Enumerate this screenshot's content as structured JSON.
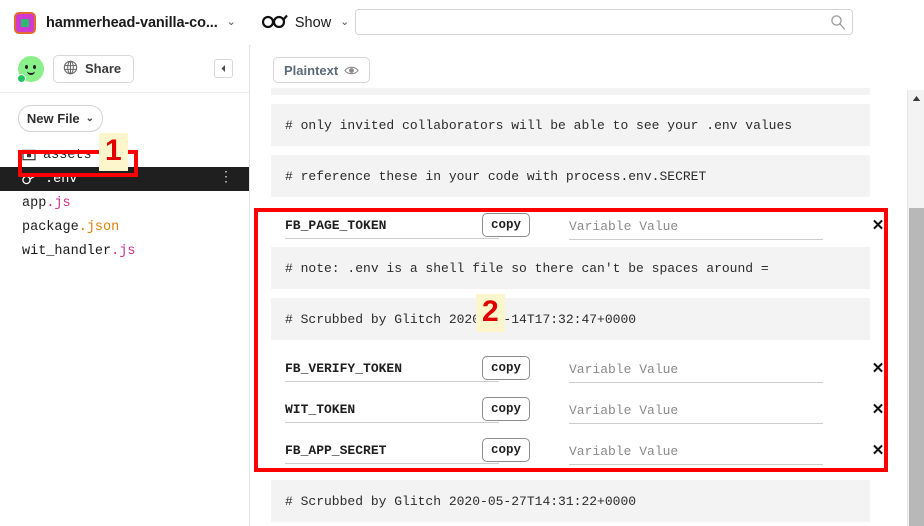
{
  "topbar": {
    "app_icon": "glitch-logo-icon",
    "project_name": "hammerhead-vanilla-co...",
    "project_chevron": "⌄",
    "show_icon": "glasses-icon",
    "show_label": "Show",
    "show_chevron": "⌄",
    "search": {
      "value": "",
      "placeholder": "",
      "icon": "search-icon"
    }
  },
  "sidebar": {
    "avatar": "user-avatar",
    "share_icon": "globe-icon",
    "share_label": "Share",
    "collapse_icon": "collapse-panel-icon",
    "new_file_label": "New File",
    "new_file_chevron": "⌄",
    "files": [
      {
        "name": "assets",
        "icon": "folder-icon",
        "active": false,
        "ext": ""
      },
      {
        "name": ".env",
        "icon": "key-icon",
        "active": true,
        "ext": ""
      },
      {
        "name": "app",
        "ext": ".js",
        "ext_class": "ext-js",
        "icon": "",
        "active": false
      },
      {
        "name": "package",
        "ext": ".json",
        "ext_class": "ext-json",
        "icon": "",
        "active": false
      },
      {
        "name": "wit_handler",
        "ext": ".js",
        "ext_class": "ext-js",
        "icon": "",
        "active": false
      }
    ],
    "kebab_glyph": "⋮"
  },
  "main": {
    "plaintext_label": "Plaintext",
    "plaintext_icon": "eye-icon",
    "lines": [
      {
        "type": "comment-stub",
        "text": ""
      },
      {
        "type": "comment",
        "text": "# only invited collaborators will be able to see your .env values"
      },
      {
        "type": "comment",
        "text": "# reference these in your code with process.env.SECRET"
      }
    ],
    "rows": [
      {
        "key": "FB_PAGE_TOKEN",
        "copy_label": "copy",
        "value": "",
        "value_placeholder": "Variable Value",
        "delete_glyph": "✕"
      }
    ],
    "mid_lines": [
      {
        "type": "comment",
        "text": "# note: .env is a shell file so there can't be spaces around ="
      },
      {
        "type": "comment",
        "text": "# Scrubbed by Glitch 2020-05-14T17:32:47+0000"
      }
    ],
    "rows2": [
      {
        "key": "FB_VERIFY_TOKEN",
        "copy_label": "copy",
        "value": "",
        "value_placeholder": "Variable Value",
        "delete_glyph": "✕"
      },
      {
        "key": "WIT_TOKEN",
        "copy_label": "copy",
        "value": "",
        "value_placeholder": "Variable Value",
        "delete_glyph": "✕"
      },
      {
        "key": "FB_APP_SECRET",
        "copy_label": "copy",
        "value": "",
        "value_placeholder": "Variable Value",
        "delete_glyph": "✕"
      }
    ],
    "tail_lines": [
      {
        "type": "comment",
        "text": "# Scrubbed by Glitch 2020-05-27T14:31:22+0000"
      }
    ]
  },
  "scrollbar": {
    "up_arrow": "▲"
  },
  "annotations": {
    "marker_1": "1",
    "marker_2": "2",
    "box_color": "#ff0000",
    "marker_color": "#e00000",
    "marker_bg": "#fdf6cc"
  }
}
